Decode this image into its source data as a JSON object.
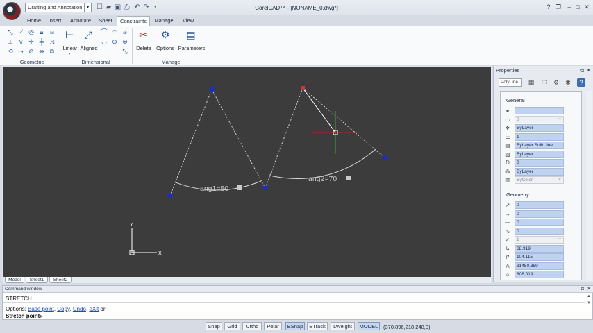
{
  "titlebar": {
    "workspace": "Drafting and Annotation",
    "title": "CorelCAD™ - [NONAME_0.dwg*]"
  },
  "ribbon": {
    "tabs": [
      "Home",
      "Insert",
      "Annotate",
      "Sheet",
      "Constraints",
      "Manage",
      "View"
    ],
    "active_tab": "Constraints",
    "groups": {
      "geometric": "Geometric",
      "dimensional": "Dimensional",
      "manage": "Manage"
    },
    "buttons": {
      "linear": "Linear",
      "aligned": "Aligned",
      "delete": "Delete",
      "options": "Options",
      "parameters": "Parameters"
    }
  },
  "drawing": {
    "labels": {
      "ang1": "ang1=50",
      "ang2": "ang2=70",
      "axis_x": "X",
      "axis_y": "Y"
    }
  },
  "layout_tabs": [
    "Model",
    "Sheet1",
    "Sheet2"
  ],
  "properties": {
    "title": "Properties",
    "entity_type": "PolyLine",
    "general_label": "General",
    "geometry_label": "Geometry",
    "general_rows": [
      {
        "icon": "color-icon",
        "value": "",
        "muted": false
      },
      {
        "icon": "layer-icon",
        "value": "0",
        "muted": true
      },
      {
        "icon": "linetype-icon",
        "value": "ByLayer",
        "muted": false
      },
      {
        "icon": "linescale-icon",
        "value": "1",
        "muted": false
      },
      {
        "icon": "linestyle-icon",
        "value": "ByLayer    Solid line",
        "muted": false
      },
      {
        "icon": "lineweight-icon",
        "value": "ByLayer",
        "muted": false
      },
      {
        "icon": "thickness-icon",
        "value": "0",
        "muted": false
      },
      {
        "icon": "hyperlink-icon",
        "value": "ByLayer",
        "muted": false
      },
      {
        "icon": "printstyle-icon",
        "value": "ByColor",
        "muted": true
      }
    ],
    "geometry_rows": [
      {
        "icon": "vertex-icon",
        "value": "0",
        "muted": false
      },
      {
        "icon": "vertex-x-icon",
        "value": "0",
        "muted": false
      },
      {
        "icon": "vertex-y-icon",
        "value": "0",
        "muted": false
      },
      {
        "icon": "start-width-icon",
        "value": "0",
        "muted": false
      },
      {
        "icon": "end-width-icon",
        "value": "1",
        "muted": true
      },
      {
        "icon": "global-width-icon",
        "value": "68.919",
        "muted": false
      },
      {
        "icon": "elevation-icon",
        "value": "104.115",
        "muted": false
      },
      {
        "icon": "area-icon",
        "value": "31450.359",
        "muted": false
      },
      {
        "icon": "length-icon",
        "value": "808.019",
        "muted": false
      }
    ]
  },
  "command_window": {
    "title": "Command window",
    "line1": "STRETCH",
    "options_prefix": "Options: ",
    "options": [
      "Base point",
      "Copy",
      "Undo",
      "eXit"
    ],
    "options_suffix": " or",
    "prompt": "Stretch point»"
  },
  "statusbar": {
    "buttons": [
      {
        "label": "Snap",
        "on": false
      },
      {
        "label": "Grid",
        "on": false
      },
      {
        "label": "Ortho",
        "on": false
      },
      {
        "label": "Polar",
        "on": false
      },
      {
        "label": "ESnap",
        "on": true
      },
      {
        "label": "ETrack",
        "on": false
      },
      {
        "label": "LWeight",
        "on": false
      },
      {
        "label": "MODEL",
        "on": true
      }
    ],
    "coords": "(370.896,218.248,0)"
  }
}
